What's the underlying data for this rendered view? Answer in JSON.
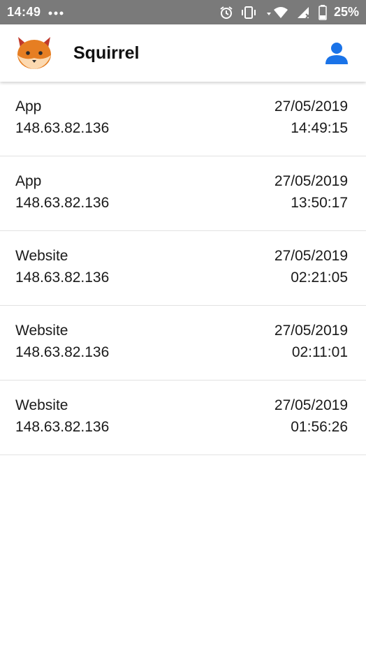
{
  "status_bar": {
    "time": "14:49",
    "battery": "25%",
    "icons": [
      "dots-icon",
      "alarm-icon",
      "vibrate-icon",
      "wifi-icon",
      "signal-icon",
      "battery-icon"
    ]
  },
  "app_bar": {
    "title": "Squirrel",
    "logo_icon": "fox-logo-icon",
    "account_icon": "person-icon",
    "accent_color": "#1a73e8"
  },
  "sessions": [
    {
      "source": "App",
      "ip": "148.63.82.136",
      "date": "27/05/2019",
      "time": "14:49:15"
    },
    {
      "source": "App",
      "ip": "148.63.82.136",
      "date": "27/05/2019",
      "time": "13:50:17"
    },
    {
      "source": "Website",
      "ip": "148.63.82.136",
      "date": "27/05/2019",
      "time": "02:21:05"
    },
    {
      "source": "Website",
      "ip": "148.63.82.136",
      "date": "27/05/2019",
      "time": "02:11:01"
    },
    {
      "source": "Website",
      "ip": "148.63.82.136",
      "date": "27/05/2019",
      "time": "01:56:26"
    }
  ]
}
